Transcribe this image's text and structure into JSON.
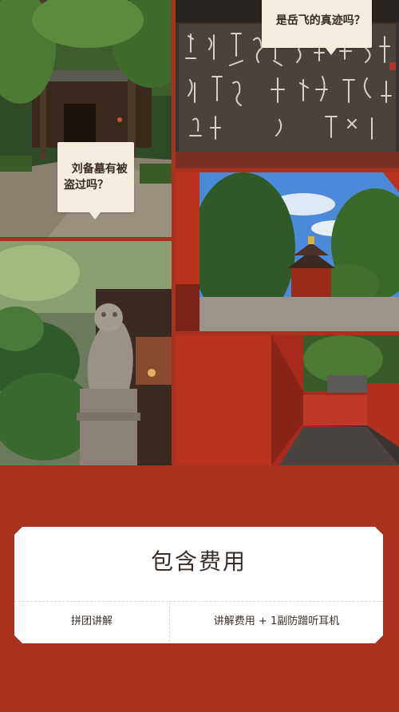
{
  "photos": {
    "tomb_path": {
      "caption": "刘备墓有被\n盗过吗？"
    },
    "calligraphy": {
      "caption": "是岳飞的真迹吗？"
    },
    "temple_gate": {},
    "stone_lion": {},
    "red_wall": {}
  },
  "fee_card": {
    "title": "包含费用",
    "rows": [
      {
        "item": "拼团讲解",
        "detail": "讲解费用 + 1副防蹭听耳机"
      }
    ]
  },
  "colors": {
    "background": "#a8321f",
    "card": "#ffffff",
    "bubble": "#f4ecdc"
  }
}
